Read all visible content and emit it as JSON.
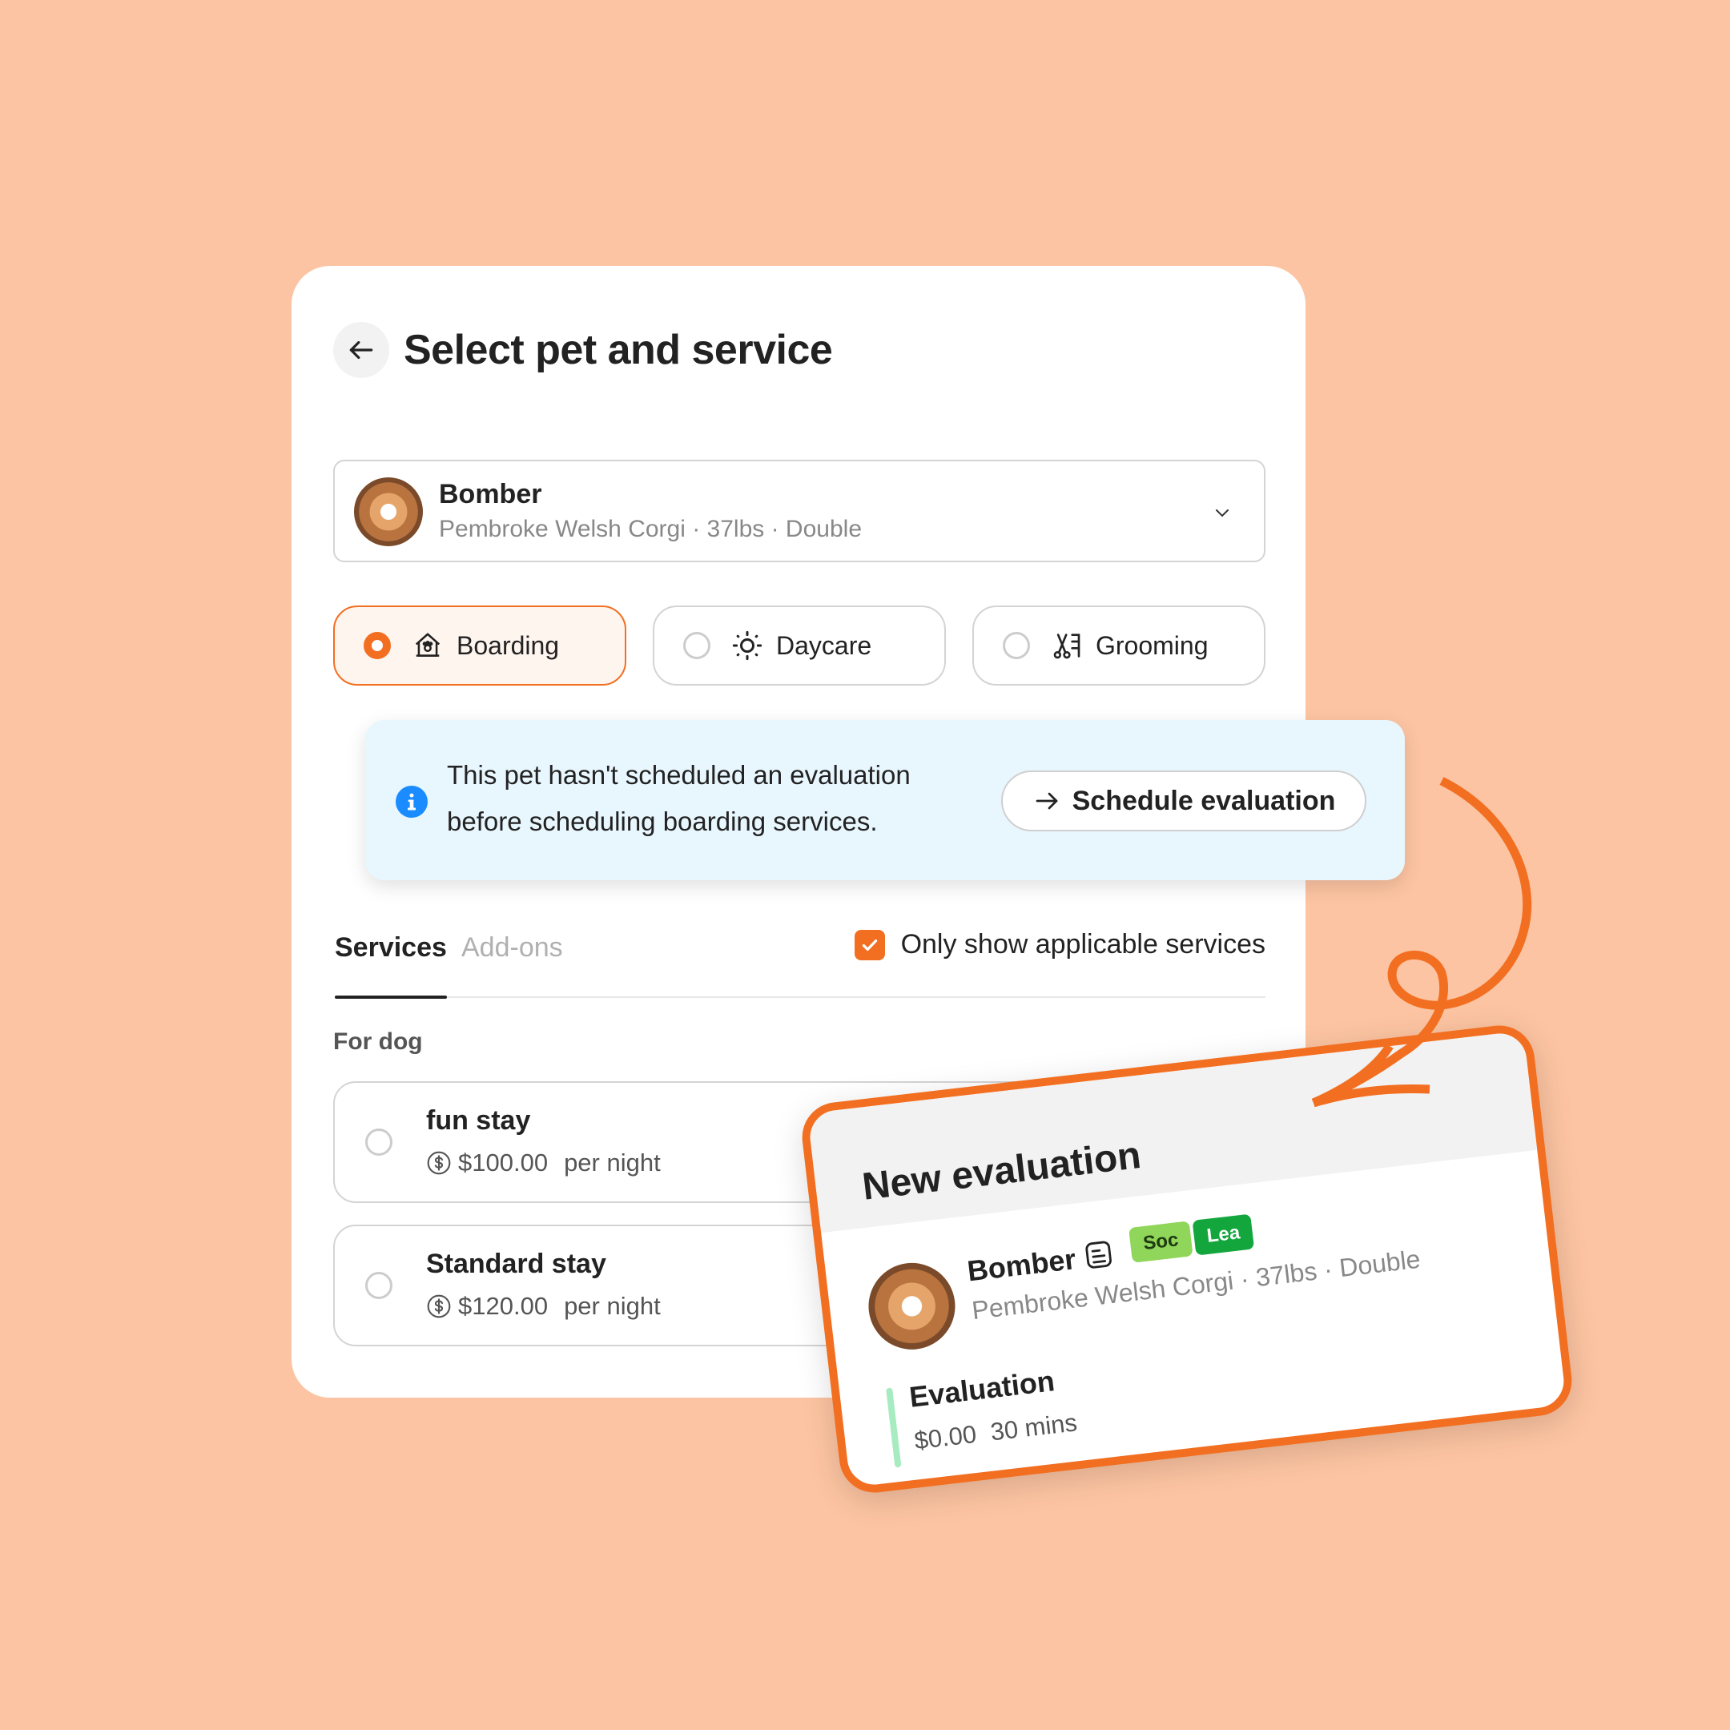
{
  "header": {
    "title": "Select pet and service",
    "back_icon": "arrow-left-icon"
  },
  "pet_selector": {
    "name": "Bomber",
    "details": "Pembroke Welsh Corgi · 37lbs · Double",
    "avatar": "corgi-avatar",
    "dropdown_icon": "chevron-down-icon"
  },
  "service_types": [
    {
      "label": "Boarding",
      "icon": "house-paw-icon",
      "selected": true
    },
    {
      "label": "Daycare",
      "icon": "sun-icon",
      "selected": false
    },
    {
      "label": "Grooming",
      "icon": "scissors-comb-icon",
      "selected": false
    }
  ],
  "banner": {
    "message_line1": "This pet hasn't scheduled an evaluation",
    "message_line2": "before scheduling boarding services.",
    "icon": "info-icon",
    "button_label": "Schedule evaluation",
    "button_icon": "arrow-right-icon"
  },
  "tabs": [
    {
      "label": "Services",
      "active": true
    },
    {
      "label": "Add-ons",
      "active": false
    }
  ],
  "filter": {
    "label": "Only show applicable services",
    "checked": true
  },
  "section_label": "For dog",
  "services": [
    {
      "name": "fun stay",
      "price": "$100.00",
      "unit": "per night",
      "selected": false
    },
    {
      "name": "Standard stay",
      "price": "$120.00",
      "unit": "per night",
      "selected": false
    }
  ],
  "evaluation_card": {
    "title": "New evaluation",
    "pet_name": "Bomber",
    "pet_details": "Pembroke Welsh Corgi · 37lbs · Double",
    "note_icon": "note-icon",
    "tags": [
      {
        "label": "Soc",
        "color": "#8FD65A"
      },
      {
        "label": "Lea",
        "color": "#12A63D"
      }
    ],
    "service_name": "Evaluation",
    "price": "$0.00",
    "duration": "30 mins"
  },
  "colors": {
    "background": "#FCC4A2",
    "accent": "#F26F21",
    "info_blue": "#1A8CFF",
    "banner_bg": "#E8F6FE"
  }
}
